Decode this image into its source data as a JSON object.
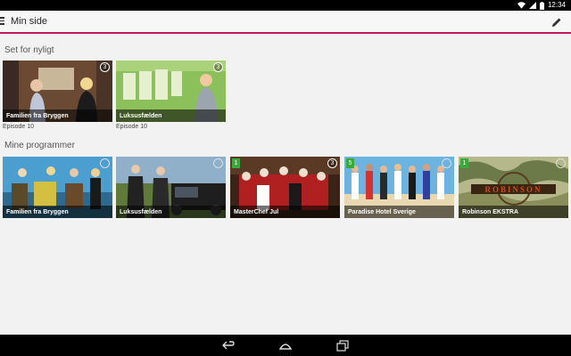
{
  "status_bar": {
    "time": "12:34",
    "icons": [
      "wifi-icon",
      "signal-icon",
      "battery-icon"
    ]
  },
  "app_bar": {
    "title": "Min side",
    "menu_icon": "hamburger-menu-icon",
    "edit_icon": "pencil-icon",
    "accent": "#c2185b"
  },
  "recent": {
    "title": "Set for nyligt",
    "items": [
      {
        "title": "Familien fra Bryggen",
        "episode": "Episode 10",
        "count": "3"
      },
      {
        "title": "Luksusfælden",
        "episode": "Episode 10",
        "count": "3"
      }
    ]
  },
  "programs": {
    "title": "Mine programmer",
    "items": [
      {
        "title": "Familien fra Bryggen",
        "count": "",
        "new": ""
      },
      {
        "title": "Luksusfælden",
        "count": "",
        "new": ""
      },
      {
        "title": "MasterChef Jul",
        "count": "3",
        "new": "1"
      },
      {
        "title": "Paradise Hotel Sverige",
        "count": "",
        "new": "5"
      },
      {
        "title": "Robinson EKSTRA",
        "count": "",
        "new": "1",
        "logo_text": "ROBINSON"
      }
    ]
  },
  "nav_bar": {
    "icons": [
      "back-icon",
      "home-icon",
      "recents-icon"
    ]
  }
}
